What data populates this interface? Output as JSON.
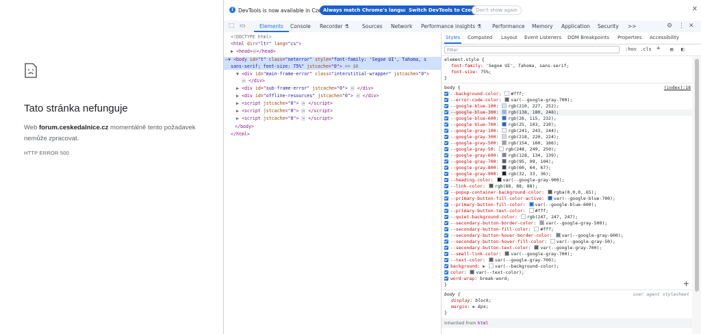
{
  "error_page": {
    "title": "Tato stránka nefunguje",
    "desc_prefix": "Web ",
    "domain": "forum.ceskedalnice.cz",
    "desc_suffix": " momentálně tento požadavek nemůže zpracovat.",
    "code": "HTTP ERROR 500",
    "icon": "sad-page-icon"
  },
  "infobar": {
    "text": "DevTools is now available in Czech!",
    "btn_match": "Always match Chrome's language",
    "btn_switch": "Switch DevTools to Czech",
    "btn_dont": "Don't show again"
  },
  "tabs": [
    "Elements",
    "Console",
    "Recorder ⚗",
    "Sources",
    "Network",
    "Performance insights ⚗",
    "Performance",
    "Memory",
    "Application",
    "Security",
    ">>"
  ],
  "elements": {
    "doctype": "<!DOCTYPE html>",
    "html_open": [
      "html",
      "dir",
      "ltr",
      "lang",
      "cs"
    ],
    "head": "head",
    "body_line1": [
      "body",
      "id",
      "t",
      "class",
      "neterror",
      "style",
      "font-family: 'Segoe UI', Tahoma, s"
    ],
    "body_line2": "sans-serif; font-size: 75%\"",
    "body_jst": "jstcache",
    "body_jst_val": "0",
    "body_eq": "== $0",
    "main_frame": [
      "div",
      "id",
      "main-frame-error",
      "class",
      "interstitial-wrapper",
      "jstcache",
      "0"
    ],
    "div_close": "</div>",
    "sub_frame": [
      "div",
      "id",
      "sub-frame-error",
      "jstcache",
      "0"
    ],
    "offline": [
      "div",
      "id",
      "offline-resources",
      "jstcache",
      "0"
    ],
    "script": "script",
    "jst_attr": "jstcache",
    "jst_val": "0",
    "body_close": "</body>",
    "html_close": "</html>"
  },
  "styles_tabs": [
    "Styles",
    "Computed",
    "Layout",
    "Event Listeners",
    "DOM Breakpoints",
    "Properties",
    "Accessibility"
  ],
  "filter": {
    "placeholder": "Filter",
    "hov": ":hov",
    "cls": ".cls"
  },
  "element_style": {
    "selector": "element.style {",
    "props": [
      {
        "name": "font-family",
        "value": "'Segoe UI', Tahoma, sans-serif;"
      },
      {
        "name": "font-size",
        "value": "75%;"
      }
    ]
  },
  "body_rule": {
    "selector": "body {",
    "source": "(index):18",
    "props": [
      {
        "name": "--background-color",
        "value": "#fff;",
        "swatch": "#ffffff"
      },
      {
        "name": "--error-code-color",
        "value": "var(--google-gray-700);",
        "swatch": "#5f6368"
      },
      {
        "name": "--google-blue-100",
        "value": "rgb(210, 227, 252);",
        "swatch": "#d2e3fc"
      },
      {
        "name": "--google-blue-300",
        "value": "rgb(138, 180, 248);",
        "swatch": "#8ab4f8"
      },
      {
        "name": "--google-blue-600",
        "value": "rgb(26, 115, 232);",
        "swatch": "#1a73e8"
      },
      {
        "name": "--google-blue-700",
        "value": "rgb(25, 103, 210);",
        "swatch": "#1967d2"
      },
      {
        "name": "--google-gray-100",
        "value": "rgb(241, 243, 244);",
        "swatch": "#f1f3f4"
      },
      {
        "name": "--google-gray-300",
        "value": "rgb(218, 220, 224);",
        "swatch": "#dadce0"
      },
      {
        "name": "--google-gray-500",
        "value": "rgb(154, 160, 166);",
        "swatch": "#9aa0a6"
      },
      {
        "name": "--google-gray-50",
        "value": "rgb(248, 249, 250);",
        "swatch": "#f8f9fa"
      },
      {
        "name": "--google-gray-600",
        "value": "rgb(128, 134, 139);",
        "swatch": "#80868b"
      },
      {
        "name": "--google-gray-700",
        "value": "rgb(95, 99, 104);",
        "swatch": "#5f6368"
      },
      {
        "name": "--google-gray-800",
        "value": "rgb(60, 64, 67);",
        "swatch": "#3c4043"
      },
      {
        "name": "--google-gray-900",
        "value": "rgb(32, 33, 36);",
        "swatch": "#202124"
      },
      {
        "name": "--heading-color",
        "value": "var(--google-gray-900);",
        "swatch": "#202124"
      },
      {
        "name": "--link-color",
        "value": "rgb(88, 88, 88);",
        "swatch": "#585858"
      },
      {
        "name": "--popup-container-background-color",
        "value": "rgba(0,0,0,.65);",
        "swatch": "#595959"
      },
      {
        "name": "--primary-button-fill-color-active",
        "value": "var(--google-blue-700);",
        "swatch": "#1967d2"
      },
      {
        "name": "--primary-button-fill-color",
        "value": "var(--google-blue-600);",
        "swatch": "#1a73e8"
      },
      {
        "name": "--primary-button-text-color",
        "value": "#fff;",
        "swatch": "#ffffff"
      },
      {
        "name": "--quiet-background-color",
        "value": "rgb(247, 247, 247);",
        "swatch": "#f7f7f7"
      },
      {
        "name": "--secondary-button-border-color",
        "value": "var(--google-gray-500);",
        "swatch": "#9aa0a6"
      },
      {
        "name": "--secondary-button-fill-color",
        "value": "#fff;",
        "swatch": "#ffffff"
      },
      {
        "name": "--secondary-button-hover-border-color",
        "value": "var(--google-gray-600);",
        "swatch": "#80868b"
      },
      {
        "name": "--secondary-button-hover-fill-color",
        "value": "var(--google-gray-50);",
        "swatch": "#f8f9fa"
      },
      {
        "name": "--secondary-button-text-color",
        "value": "var(--google-gray-700);",
        "swatch": "#5f6368"
      },
      {
        "name": "--small-link-color",
        "value": "var(--google-gray-700);",
        "swatch": "#5f6368"
      },
      {
        "name": "--text-color",
        "value": "var(--google-gray-700);",
        "swatch": "#5f6368"
      },
      {
        "name": "background",
        "value": "var(--background-color);",
        "swatch": "#ffffff",
        "arrow": true
      },
      {
        "name": "color",
        "value": "var(--text-color);",
        "swatch": "#5f6368"
      },
      {
        "name": "word-wrap",
        "value": "break-word;"
      }
    ]
  },
  "ua_rule": {
    "selector": "body {",
    "source": "user agent stylesheet",
    "props": [
      {
        "name": "display",
        "value": "block;"
      },
      {
        "name": "margin",
        "value": "8px;"
      }
    ]
  },
  "inherited": {
    "label": "Inherited from ",
    "tag": "html"
  },
  "colors": {
    "accent": "#1a73e8",
    "selected_row": "#cfe1fc"
  }
}
